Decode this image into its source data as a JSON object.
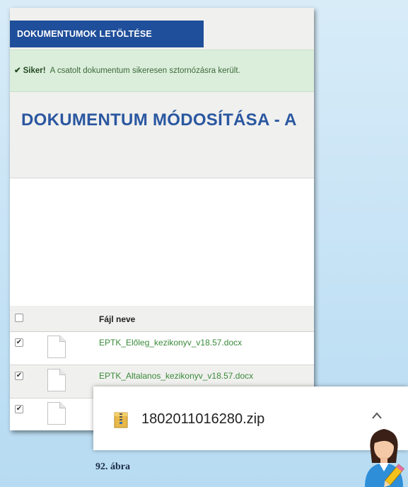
{
  "toolbar": {
    "download_label": "DOKUMENTUMOK LETÖLTÉSE"
  },
  "alert": {
    "check_glyph": "✔",
    "title": "Siker!",
    "message": "A csatolt dokumentum sikeresen sztornózásra került."
  },
  "page": {
    "title": "DOKUMENTUM MÓDOSÍTÁSA - A"
  },
  "table": {
    "column_header": "Fájl neve",
    "check_glyph": "✔",
    "rows": [
      {
        "name": "EPTK_Előleg_kezikonyv_v18.57.docx",
        "checked": true
      },
      {
        "name": "EPTK_Altalanos_kezikonyv_v18.57.docx",
        "checked": true
      },
      {
        "name": "",
        "checked": true
      }
    ]
  },
  "download": {
    "filename": "1802011016280.zip"
  },
  "figure": {
    "caption": "92. ábra"
  },
  "colors": {
    "accent": "#1f4e9a",
    "title": "#2a57a0",
    "success_bg": "#dbeedb",
    "link_green": "#3a8a3a"
  }
}
